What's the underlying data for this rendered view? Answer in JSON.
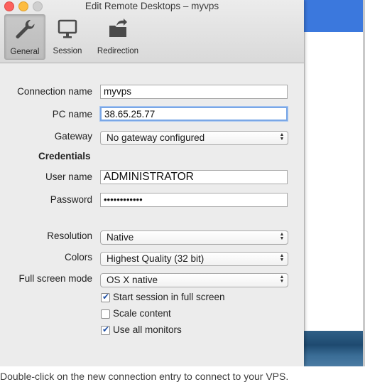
{
  "window": {
    "title": "Edit Remote Desktops – myvps"
  },
  "toolbar": {
    "items": [
      {
        "label": "General",
        "icon": "wrench-icon"
      },
      {
        "label": "Session",
        "icon": "monitor-icon"
      },
      {
        "label": "Redirection",
        "icon": "folder-arrow-icon"
      }
    ]
  },
  "form": {
    "connection_name_label": "Connection name",
    "connection_name_value": "myvps",
    "pc_name_label": "PC name",
    "pc_name_value": "38.65.25.77",
    "gateway_label": "Gateway",
    "gateway_value": "No gateway configured",
    "credentials_heading": "Credentials",
    "user_name_label": "User name",
    "user_name_value": "ADMINISTRATOR",
    "password_label": "Password",
    "password_value": "••••••••••••",
    "resolution_label": "Resolution",
    "resolution_value": "Native",
    "colors_label": "Colors",
    "colors_value": "Highest Quality (32 bit)",
    "fullscreen_label": "Full screen mode",
    "fullscreen_value": "OS X native",
    "checkboxes": [
      {
        "label": "Start session in full screen",
        "checked": true
      },
      {
        "label": "Scale content",
        "checked": false
      },
      {
        "label": "Use all monitors",
        "checked": true
      }
    ]
  },
  "caption": "Double-click on the new connection entry to connect to your VPS."
}
